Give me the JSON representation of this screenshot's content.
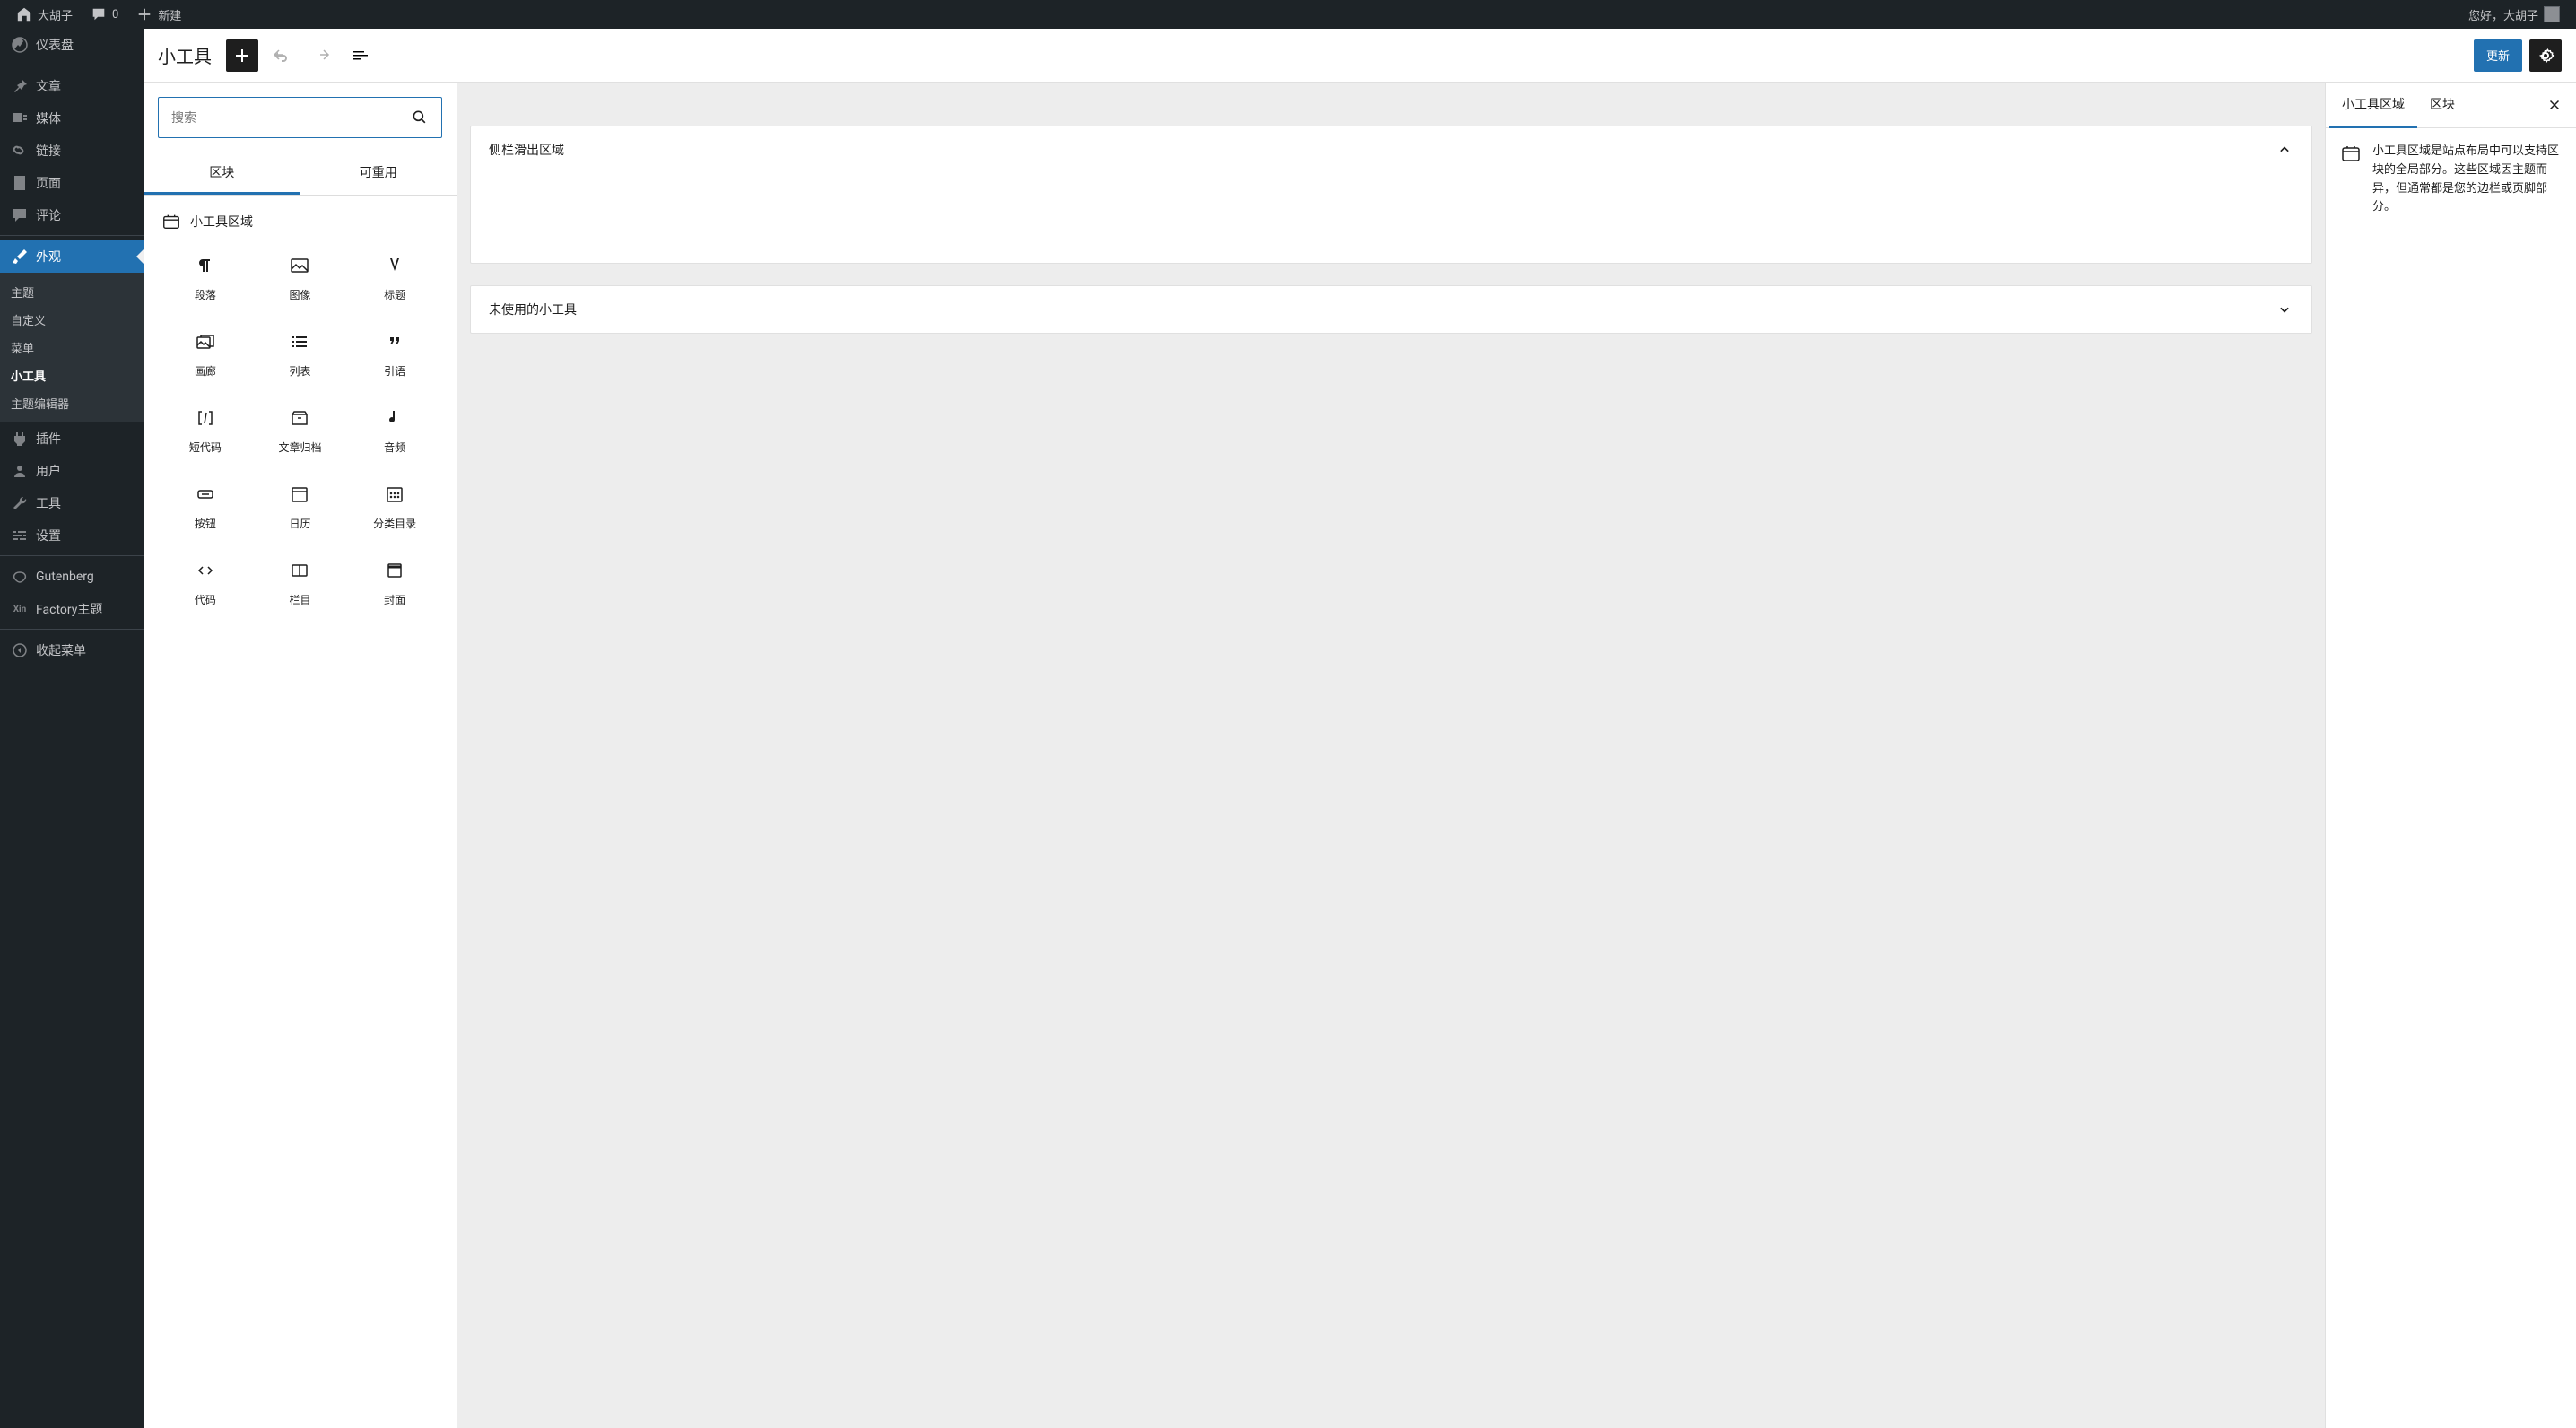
{
  "adminbar": {
    "site_name": "大胡子",
    "comments_count": "0",
    "new_label": "新建",
    "greeting": "您好，大胡子"
  },
  "sidebar": {
    "items": [
      {
        "id": "dashboard",
        "label": "仪表盘"
      },
      {
        "id": "posts",
        "label": "文章"
      },
      {
        "id": "media",
        "label": "媒体"
      },
      {
        "id": "links",
        "label": "链接"
      },
      {
        "id": "pages",
        "label": "页面"
      },
      {
        "id": "comments",
        "label": "评论"
      },
      {
        "id": "appearance",
        "label": "外观"
      },
      {
        "id": "plugins",
        "label": "插件"
      },
      {
        "id": "users",
        "label": "用户"
      },
      {
        "id": "tools",
        "label": "工具"
      },
      {
        "id": "settings",
        "label": "设置"
      },
      {
        "id": "gutenberg",
        "label": "Gutenberg"
      },
      {
        "id": "factory",
        "label": "Factory主题"
      },
      {
        "id": "collapse",
        "label": "收起菜单"
      }
    ],
    "submenu": [
      {
        "id": "themes",
        "label": "主题"
      },
      {
        "id": "customize",
        "label": "自定义"
      },
      {
        "id": "menus",
        "label": "菜单"
      },
      {
        "id": "widgets",
        "label": "小工具"
      },
      {
        "id": "theme-editor",
        "label": "主题编辑器"
      }
    ]
  },
  "editor_header": {
    "title": "小工具",
    "update_label": "更新"
  },
  "inserter": {
    "search_placeholder": "搜索",
    "tabs": {
      "blocks": "区块",
      "reusable": "可重用"
    },
    "category_label": "小工具区域",
    "blocks": [
      {
        "id": "paragraph",
        "label": "段落"
      },
      {
        "id": "image",
        "label": "图像"
      },
      {
        "id": "heading",
        "label": "标题"
      },
      {
        "id": "gallery",
        "label": "画廊"
      },
      {
        "id": "list",
        "label": "列表"
      },
      {
        "id": "quote",
        "label": "引语"
      },
      {
        "id": "shortcode",
        "label": "短代码"
      },
      {
        "id": "archives",
        "label": "文章归档"
      },
      {
        "id": "audio",
        "label": "音频"
      },
      {
        "id": "button",
        "label": "按钮"
      },
      {
        "id": "calendar",
        "label": "日历"
      },
      {
        "id": "categories",
        "label": "分类目录"
      },
      {
        "id": "code",
        "label": "代码"
      },
      {
        "id": "columns",
        "label": "栏目"
      },
      {
        "id": "cover",
        "label": "封面"
      }
    ]
  },
  "canvas": {
    "areas": [
      {
        "id": "sidebar-slide",
        "title": "侧栏滑出区域",
        "expanded": true
      },
      {
        "id": "inactive",
        "title": "未使用的小工具",
        "expanded": false
      }
    ]
  },
  "panel": {
    "tabs": {
      "areas": "小工具区域",
      "block": "区块"
    },
    "description": "小工具区域是站点布局中可以支持区块的全局部分。这些区域因主题而异，但通常都是您的边栏或页脚部分。"
  }
}
